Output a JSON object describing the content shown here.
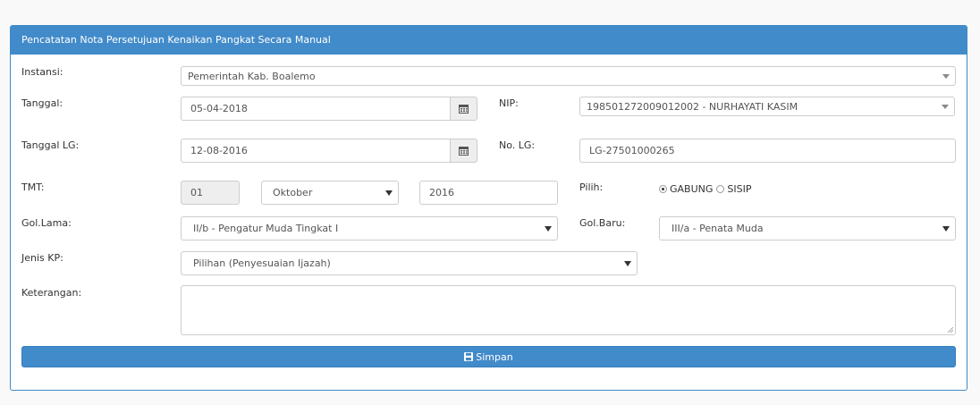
{
  "panel": {
    "title": "Pencatatan Nota Persetujuan Kenaikan Pangkat Secara Manual"
  },
  "labels": {
    "instansi": "Instansi:",
    "tanggal": "Tanggal:",
    "nip": "NIP:",
    "tanggal_lg": "Tanggal LG:",
    "no_lg": "No. LG:",
    "tmt": "TMT:",
    "pilih": "Pilih:",
    "gol_lama": "Gol.Lama:",
    "gol_baru": "Gol.Baru:",
    "jenis_kp": "Jenis KP:",
    "keterangan": "Keterangan:"
  },
  "fields": {
    "instansi": "Pemerintah Kab. Boalemo",
    "tanggal": "05-04-2018",
    "nip": "198501272009012002 - NURHAYATI KASIM",
    "tanggal_lg": "12-08-2016",
    "no_lg": "LG-27501000265",
    "tmt_day": "01",
    "tmt_month": "Oktober",
    "tmt_year": "2016",
    "gol_lama": "II/b - Pengatur Muda Tingkat I",
    "gol_baru": "III/a - Penata Muda",
    "jenis_kp": "Pilihan (Penyesuaian Ijazah)",
    "keterangan": ""
  },
  "pilih_options": [
    {
      "label": "GABUNG",
      "checked": true
    },
    {
      "label": "SISIP",
      "checked": false
    }
  ],
  "button": {
    "simpan": "Simpan",
    "icon": "floppy-disk-icon"
  },
  "colors": {
    "primary": "#428bca"
  }
}
